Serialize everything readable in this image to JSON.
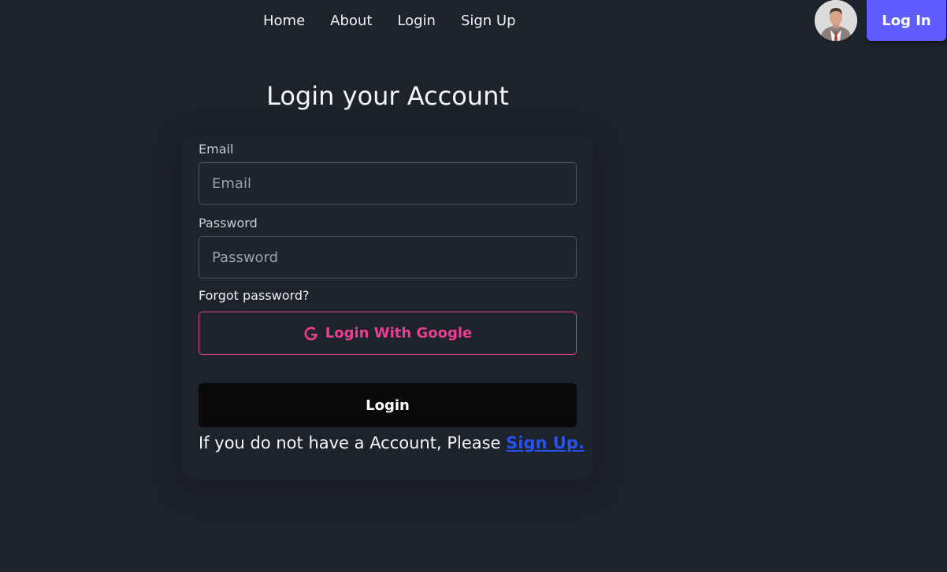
{
  "nav": {
    "links": [
      "Home",
      "About",
      "Login",
      "Sign Up"
    ],
    "login_button": "Log In",
    "accent_color": "#605dff"
  },
  "form": {
    "title": "Login your Account",
    "email_label": "Email",
    "email_placeholder": "Email",
    "password_label": "Password",
    "password_placeholder": "Password",
    "forgot_password": "Forgot password?",
    "google_button": "Login With Google",
    "google_color": "#ec3f91",
    "submit_button": "Login",
    "signup_prompt": "If you do not have a Account, Please",
    "signup_link": "Sign Up."
  }
}
